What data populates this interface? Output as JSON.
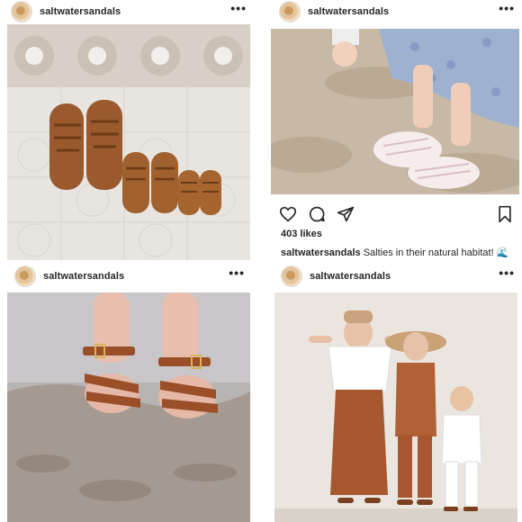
{
  "posts": [
    {
      "username": "saltwatersandals",
      "more": "•••"
    },
    {
      "username": "saltwatersandals",
      "more": "•••",
      "likes": "403 likes",
      "caption_user": "saltwatersandals",
      "caption_text": "Salties in their natural habitat! 🌊"
    },
    {
      "username": "saltwatersandals",
      "more": "•••"
    },
    {
      "username": "saltwatersandals",
      "more": "•••"
    }
  ],
  "icons": {
    "heart": "heart-icon",
    "comment": "comment-icon",
    "share": "share-icon",
    "save": "bookmark-icon"
  }
}
